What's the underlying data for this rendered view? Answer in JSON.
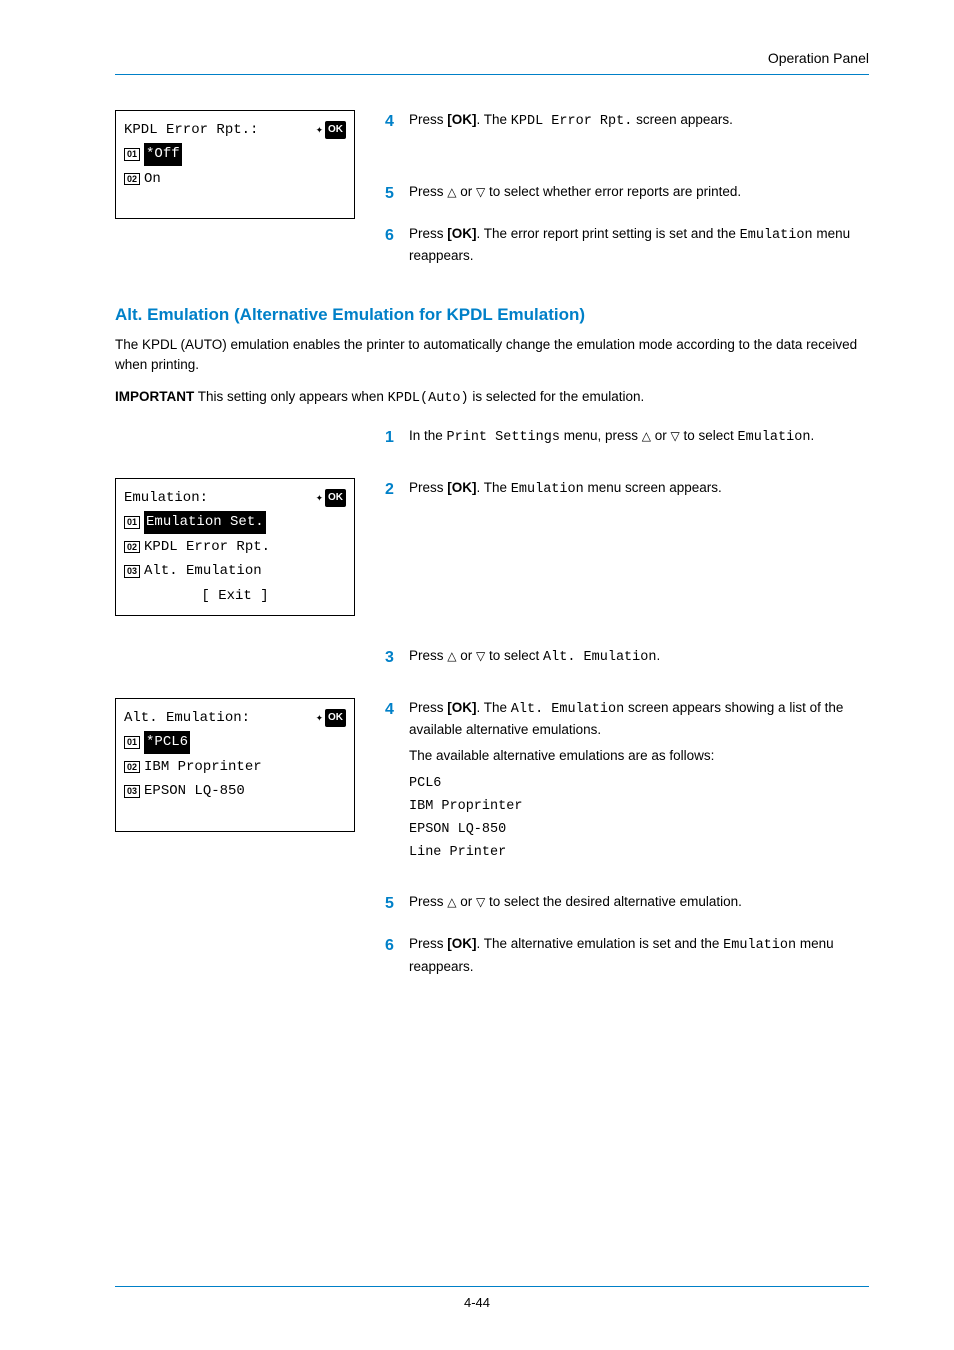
{
  "header": {
    "title": "Operation Panel"
  },
  "screen1": {
    "title": "KPDL Error Rpt.:",
    "ok": "OK",
    "items": [
      {
        "num": "01",
        "text": "*Off",
        "selected": true
      },
      {
        "num": "02",
        "text": "On",
        "selected": false
      }
    ]
  },
  "steps1": [
    {
      "n": "4",
      "pre": "Press ",
      "key": "[OK]",
      "mid": ". The ",
      "mono": "KPDL Error Rpt.",
      "post": " screen appears."
    },
    {
      "n": "5",
      "pre": "Press ",
      "tri_up": "△",
      "or": " or ",
      "tri_down": "▽",
      "post": " to select whether error reports are printed."
    },
    {
      "n": "6",
      "pre": "Press ",
      "key": "[OK]",
      "mid": ". The error report print setting is set and the ",
      "mono": "Emulation",
      "post": " menu reappears."
    }
  ],
  "section1": {
    "heading": "Alt. Emulation (Alternative Emulation for KPDL Emulation)",
    "para": "The KPDL (AUTO) emulation enables the printer to automatically change the emulation mode according to the data received when printing.",
    "important_label": "IMPORTANT",
    "important_pre": "  This setting only appears when ",
    "important_mono": "KPDL(Auto)",
    "important_post": " is selected for the emulation."
  },
  "steps2_top": [
    {
      "n": "1",
      "pre": "In the ",
      "mono1": "Print Settings",
      "mid": " menu, press ",
      "tri_up": "△",
      "or": " or ",
      "tri_down": "▽",
      "mid2": " to select ",
      "mono2": "Emulation",
      "post": "."
    },
    {
      "n": "2",
      "pre": "Press ",
      "key": "[OK]",
      "mid": ". The ",
      "mono": "Emulation",
      "post": " menu screen appears."
    }
  ],
  "screen2": {
    "title": "Emulation:",
    "ok": "OK",
    "items": [
      {
        "num": "01",
        "text": "Emulation Set.",
        "selected": true
      },
      {
        "num": "02",
        "text": "KPDL Error Rpt.",
        "selected": false
      },
      {
        "num": "03",
        "text": "Alt. Emulation",
        "selected": false
      }
    ],
    "exit": "[  Exit  ]"
  },
  "screen3": {
    "title": "Alt. Emulation:",
    "ok": "OK",
    "items": [
      {
        "num": "01",
        "text": "*PCL6",
        "selected": true
      },
      {
        "num": "02",
        "text": "IBM Proprinter",
        "selected": false
      },
      {
        "num": "03",
        "text": "EPSON LQ-850",
        "selected": false
      }
    ]
  },
  "steps3": [
    {
      "n": "3",
      "pre": "Press ",
      "tri_up": "△",
      "or": " or ",
      "tri_down": "▽",
      "mid": " to select ",
      "mono": "Alt. Emulation",
      "post": "."
    },
    {
      "n": "4",
      "pre": "Press ",
      "key": "[OK]",
      "mid": ". The ",
      "mono": "Alt. Emulation",
      "post": " screen appears showing a list of the available alternative emulations.",
      "extra": "The available alternative emulations are as follows:"
    }
  ],
  "emulations": [
    "PCL6",
    "IBM Proprinter",
    "EPSON LQ-850",
    "Line Printer"
  ],
  "steps4": [
    {
      "n": "5",
      "pre": "Press ",
      "tri_up": "△",
      "or": " or ",
      "tri_down": "▽",
      "post": " to select the desired alternative emulation."
    },
    {
      "n": "6",
      "pre": "Press ",
      "key": "[OK]",
      "mid": ". The alternative emulation is set and the ",
      "mono": "Emulation",
      "post": " menu reappears."
    }
  ],
  "footer": {
    "page": "4-44"
  }
}
